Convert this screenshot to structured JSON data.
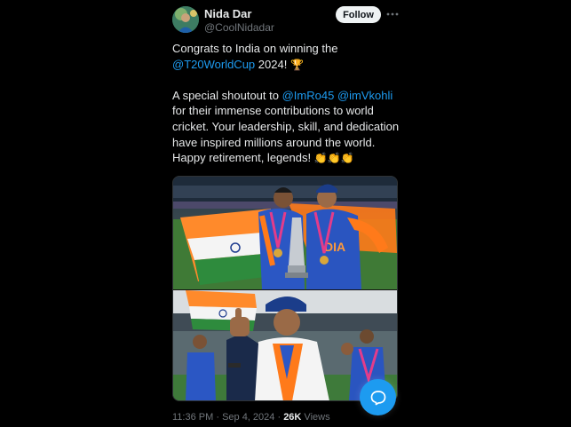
{
  "author": {
    "display_name": "Nida Dar",
    "handle": "@CoolNidadar"
  },
  "follow_button": {
    "label": "Follow"
  },
  "icons": {
    "more": "more-horizontal-icon",
    "compose": "chat-bubble-icon"
  },
  "tweet": {
    "line1": "Congrats to India on winning the",
    "hashtag": "@T20WorldCup",
    "line2_rest": " 2024! ",
    "trophy_emoji": "🏆",
    "shoutout_prefix": "A special shoutout to ",
    "mention1": "@ImRo45",
    "mention_sep": " ",
    "mention2": "@imVkohli",
    "line4": "for their immense contributions to world",
    "line5": "cricket. Your leadership, skill, and dedication",
    "line6": "have inspired millions around the world.",
    "line7_text": "Happy retirement, legends! ",
    "clap_emojis": "👏👏👏"
  },
  "meta": {
    "time": "11:36 PM",
    "separator": " · ",
    "date": "Sep 4, 2024",
    "views_count": "26K",
    "views_label": " Views"
  },
  "colors": {
    "background": "#000000",
    "text": "#e7e9ea",
    "secondary": "#71767b",
    "link": "#1d9bf0",
    "follow_bg": "#eff3f4"
  }
}
